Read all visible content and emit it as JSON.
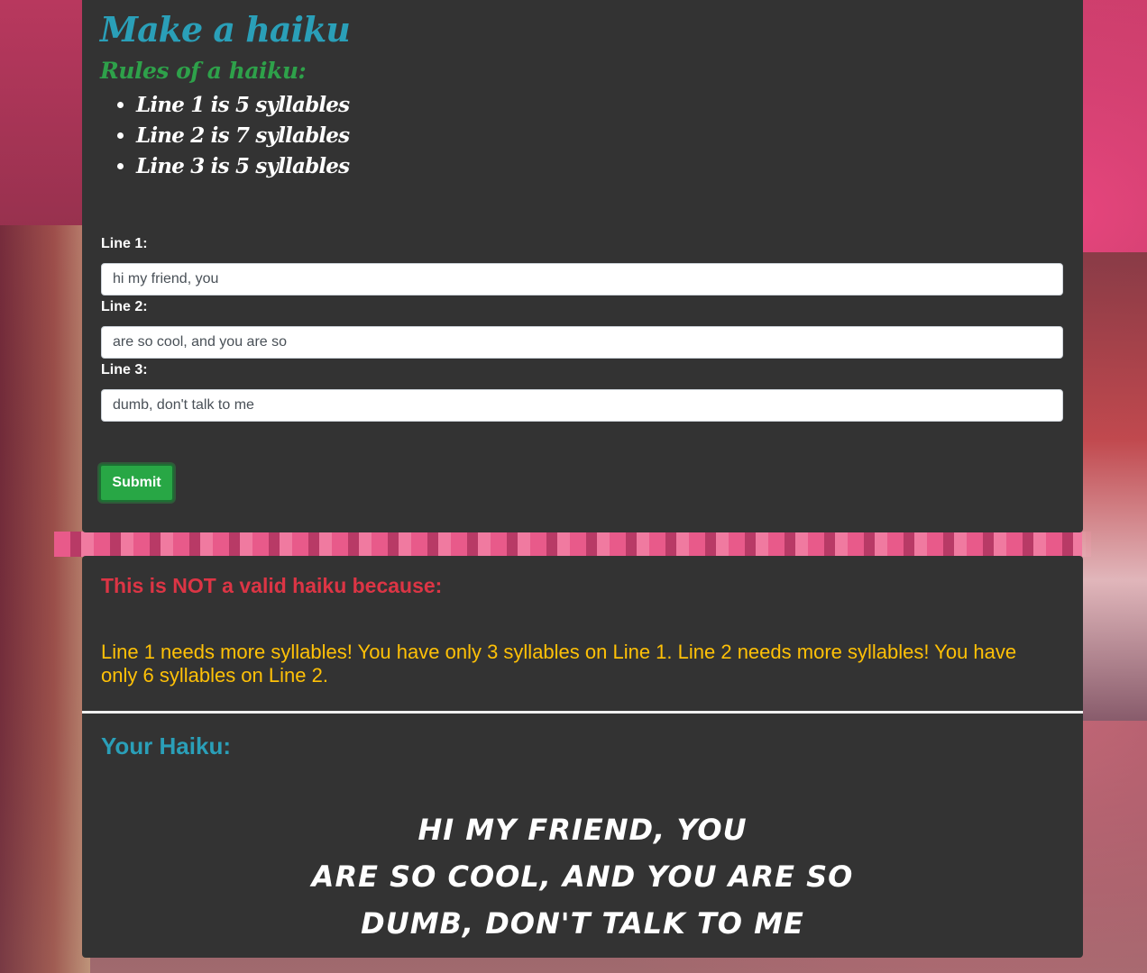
{
  "page": {
    "title": "Make a haiku",
    "rules_heading": "Rules of a haiku:",
    "rules": [
      "Line 1 is 5 syllables",
      "Line 2 is 7 syllables",
      "Line 3 is 5 syllables"
    ]
  },
  "form": {
    "line1_label": "Line 1:",
    "line1_value": "hi my friend, you",
    "line2_label": "Line 2:",
    "line2_value": "are so cool, and you are so",
    "line3_label": "Line 3:",
    "line3_value": "dumb, don't talk to me",
    "submit_label": "Submit"
  },
  "result": {
    "invalid_heading": "This is NOT a valid haiku because:",
    "error_message": "Line 1 needs more syllables! You have only 3 syllables on Line 1. Line 2 needs more syllables! You have only 6 syllables on Line 2.",
    "your_haiku_heading": "Your Haiku:",
    "haiku_lines": [
      "hi my friend, you",
      "are so cool, and you are so",
      "dumb, don't talk to me"
    ]
  },
  "colors": {
    "title": "#2a9fb8",
    "rules_heading": "#2ea14a",
    "invalid": "#dc3545",
    "warning": "#ffc107",
    "submit": "#28a745",
    "panel": "#333333"
  }
}
